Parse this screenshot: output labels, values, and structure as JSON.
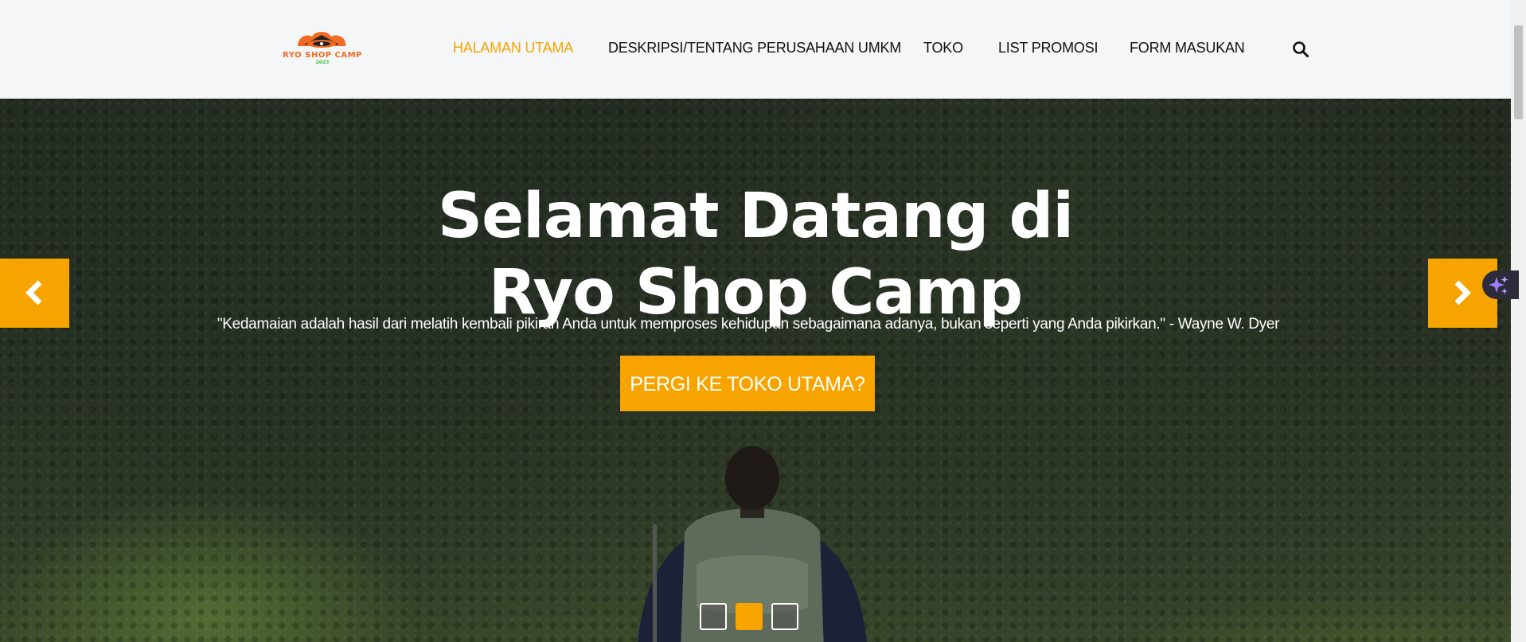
{
  "brand": {
    "logo_text": "RYO SHOP CAMP",
    "logo_year": "2023",
    "accent": "#f7a400",
    "logo_color": "#f26b21"
  },
  "nav": {
    "items": [
      {
        "label": "HALAMAN UTAMA",
        "active": true
      },
      {
        "label": "DESKRIPSI/TENTANG PERUSAHAAN UMKM",
        "active": false
      },
      {
        "label": "TOKO",
        "active": false
      },
      {
        "label": "LIST PROMOSI",
        "active": false
      },
      {
        "label": "FORM MASUKAN",
        "active": false
      }
    ],
    "search_icon": "search-icon"
  },
  "hero": {
    "title_line1": "Selamat Datang di",
    "title_line2": "Ryo Shop Camp",
    "quote": "\"Kedamaian adalah hasil dari melatih kembali pikiran Anda untuk memproses kehidupan sebagaimana adanya, bukan seperti yang Anda pikirkan.\" - Wayne W. Dyer",
    "cta_label": "PERGI KE TOKO UTAMA?",
    "prev_icon": "chevron-left-icon",
    "next_icon": "chevron-right-icon",
    "slides_total": 3,
    "active_slide": 2
  },
  "widget": {
    "icon": "sparkle-icon"
  }
}
